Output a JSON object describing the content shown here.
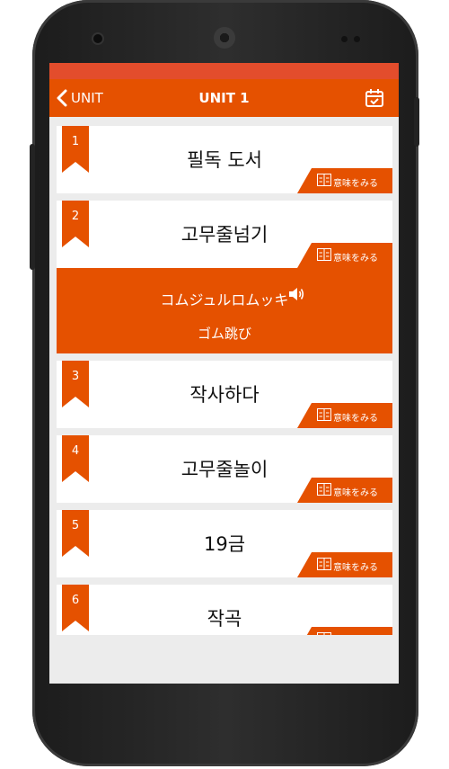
{
  "header": {
    "back_label": "UNIT",
    "title": "UNIT 1"
  },
  "meaning_label": "意味をみる",
  "items": [
    {
      "number": "1",
      "word": "필독 도서"
    },
    {
      "number": "2",
      "word": "고무줄넘기",
      "expanded": {
        "reading": "コムジュルロムッキ",
        "translation": "ゴム跳び"
      }
    },
    {
      "number": "3",
      "word": "작사하다"
    },
    {
      "number": "4",
      "word": "고무줄놀이"
    },
    {
      "number": "5",
      "word": "19금"
    },
    {
      "number": "6",
      "word": "작곡"
    }
  ],
  "colors": {
    "accent": "#e55100",
    "statusbar": "#e34d2c",
    "background": "#ececec"
  }
}
